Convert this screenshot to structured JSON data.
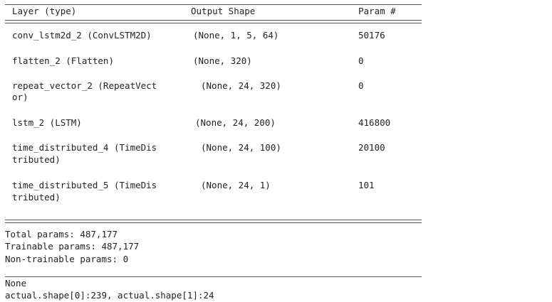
{
  "summary": {
    "headers": {
      "layer": "Layer (type)",
      "output_shape": "Output Shape",
      "param": "Param #"
    },
    "rows": [
      {
        "layer": "conv_lstm2d_2 (ConvLSTM2D)",
        "output_shape": "(None, 1, 5, 64)",
        "param": "50176"
      },
      {
        "layer": "flatten_2 (Flatten)",
        "output_shape": "(None, 320)",
        "param": "0"
      },
      {
        "layer": "repeat_vector_2 (RepeatVect",
        "layer_cont": "or)",
        "output_shape": "(None, 24, 320)",
        "param": "0"
      },
      {
        "layer": "lstm_2 (LSTM)",
        "output_shape": "(None, 24, 200)",
        "param": "416800"
      },
      {
        "layer": "time_distributed_4 (TimeDis",
        "layer_cont": "tributed)",
        "output_shape": "(None, 24, 100)",
        "param": "20100"
      },
      {
        "layer": "time_distributed_5 (TimeDis",
        "layer_cont": "tributed)",
        "output_shape": "(None, 24, 1)",
        "param": "101"
      }
    ],
    "totals": {
      "total": "Total params: 487,177",
      "trainable": "Trainable params: 487,177",
      "non_trainable": "Non-trainable params: 0"
    }
  },
  "output_lines": [
    "None",
    "actual.shape[0]:239, actual.shape[1]:24"
  ]
}
